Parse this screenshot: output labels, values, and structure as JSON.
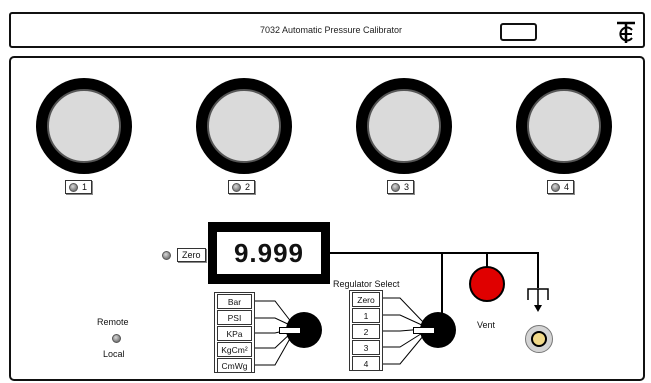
{
  "header": {
    "title": "7032 Automatic Pressure Calibrator",
    "logo_icon": "te-logo-icon"
  },
  "gauges": [
    {
      "id": "1"
    },
    {
      "id": "2"
    },
    {
      "id": "3"
    },
    {
      "id": "4"
    }
  ],
  "gauge_selectors": [
    "1",
    "2",
    "3",
    "4"
  ],
  "zero_button": {
    "label": "Zero"
  },
  "display": {
    "value": "9.999"
  },
  "units": [
    "Bar",
    "PSI",
    "KPa",
    "KgCm²",
    "CmWg"
  ],
  "regulator": {
    "title": "Regulator Select",
    "options": [
      "Zero",
      "1",
      "2",
      "3",
      "4"
    ]
  },
  "vent": {
    "label": "Vent",
    "color": "#e00000"
  },
  "mode": {
    "remote_label": "Remote",
    "local_label": "Local"
  },
  "outlet": {
    "icon": "outlet-icon",
    "fitting_color": "#f1d98a"
  }
}
